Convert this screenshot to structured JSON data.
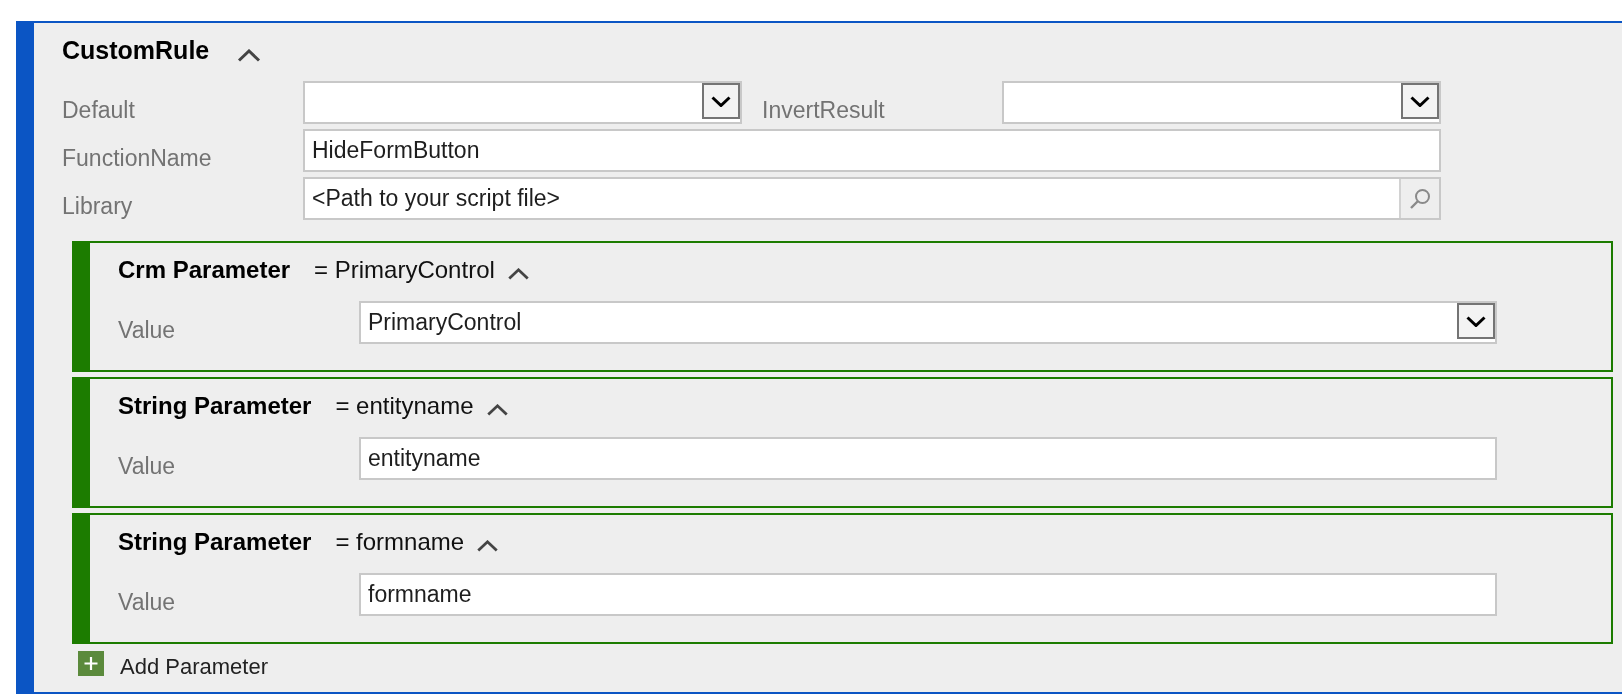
{
  "rule": {
    "title": "CustomRule",
    "expanded": true,
    "rows": [
      {
        "fields": [
          {
            "label": "Default",
            "kind": "dropdown"
          },
          {
            "label": "InvertResult",
            "kind": "dropdown"
          }
        ]
      },
      {
        "fields": [
          {
            "label": "FunctionName",
            "kind": "text",
            "value": "HideFormButton"
          }
        ]
      },
      {
        "fields": [
          {
            "label": "Library",
            "kind": "lookup",
            "value": "<Path to your script file>"
          }
        ]
      }
    ],
    "parameters": [
      {
        "type": "Crm Parameter",
        "summary": "= PrimaryControl",
        "expanded": true,
        "field": {
          "label": "Value",
          "kind": "dropdown",
          "value": "PrimaryControl"
        }
      },
      {
        "type": "String Parameter",
        "summary": "= entityname",
        "expanded": true,
        "field": {
          "label": "Value",
          "kind": "text",
          "value": "entityname"
        }
      },
      {
        "type": "String Parameter",
        "summary": "= formname",
        "expanded": true,
        "field": {
          "label": "Value",
          "kind": "text",
          "value": "formname"
        }
      }
    ],
    "add_button": {
      "label": "Add Parameter"
    }
  }
}
